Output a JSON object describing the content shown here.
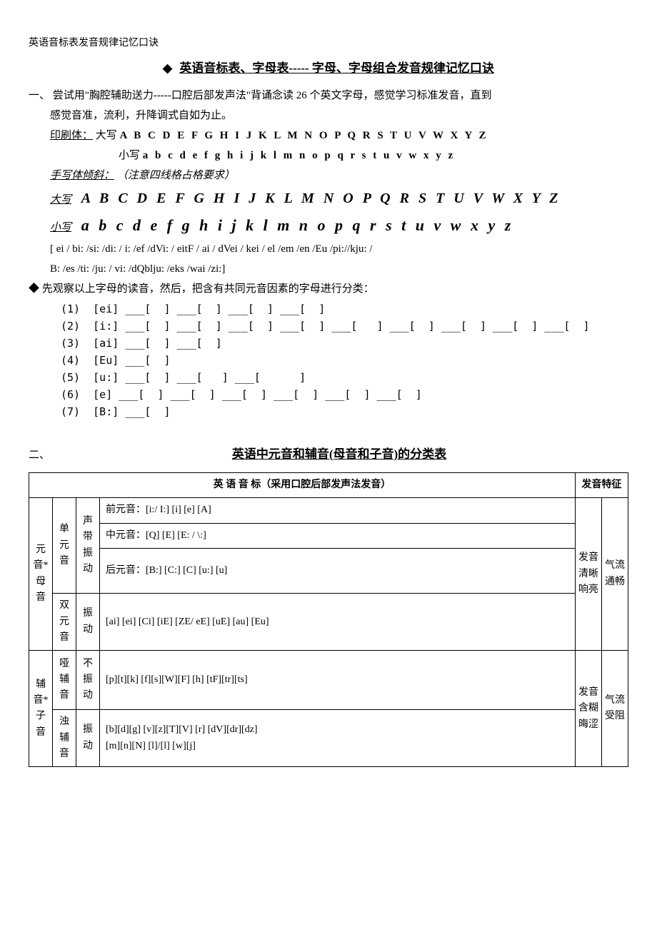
{
  "header_small": "英语音标表发音规律记忆口诀",
  "title_diamond": "◆",
  "title_text": "英语音标表、字母表----- 字母、字母组合发音规律记忆口诀",
  "sec1_num": "一、",
  "sec1_line1": "尝试用\"胸腔辅助送力-----口腔后部发声法\"背诵念读 26 个英文字母，感觉学习标准发音，直到",
  "sec1_line2": "感觉音准，流利，升降调式自如为止。",
  "print_label": "印刷体：",
  "print_upper_label": "大写   ",
  "print_upper": "A B C D E F G H I J K L M N O P Q R S T U V W X Y Z",
  "print_lower_label": "小写   ",
  "print_lower": "a b c d e f g h i j k l m n o p q r s t u v w x y z",
  "hand_label": "手写体倾斜：",
  "hand_note": "（注意四线格占格要求）",
  "hand_upper_label": "大写",
  "hand_upper": "A B C D E F G H I J K L M N O P Q R S T U V W X Y Z",
  "hand_lower_label": "小写",
  "hand_lower": "a b c d e f g h i j k l m n o p q r s t u v w x y z",
  "phon_line1": "[ ei / bi: /si: /di: /  i: /ef /dVi: / eitF / ai / dVei / kei / el /em /en /Eu /pi://kju: /",
  "phon_line2": "B: /es /ti: /ju: / vi: /dQblju: /eks /wai /zi:]",
  "diamond2": "◆",
  "observe_text": "先观察以上字母的读音，然后，把含有共同元音因素的字母进行分类：",
  "rows": [
    "(1)  [ei] ___[  ] ___[  ] ___[  ] ___[  ]",
    "(2)  [i:] ___[  ] ___[  ] ___[  ] ___[  ] ___[   ] ___[  ] ___[  ] ___[  ] ___[  ]",
    "(3)  [ai] ___[  ] ___[  ]",
    "(4)  [Eu] ___[  ]",
    "(5)  [u:] ___[  ] ___[   ] ___[      ]",
    "(6)  [e] ___[  ] ___[  ] ___[  ] ___[  ] ___[  ] ___[  ]",
    "(7)  [B:] ___[  ]"
  ],
  "sec2_num": "二、",
  "sec2_title": "英语中元音和辅音(母音和子音)的分类表",
  "table": {
    "header_main": "英   语   音   标（采用口腔后部发声法发音）",
    "header_right": "发音特征",
    "col1": [
      "元音*母音",
      "辅音*子音"
    ],
    "col2": [
      "单元音",
      "双元音",
      "哑辅音",
      "浊辅音"
    ],
    "col3": [
      "声带振动",
      "振动",
      "不振动",
      "振动"
    ],
    "vowel_rows": [
      "前元音：[i:/ I:] [i] [e] [A]",
      "中元音：[Q] [E] [E: / \\:]",
      "后元音：[B:] [C:] [C] [u:] [u]"
    ],
    "diph_row": "[ai] [ei] [Ci] [iE] [ZE/ eE] [uE] [au] [Eu]",
    "cons_row1": "[p][t][k]   [f][s][W][F]   [h]   [tF][tr][ts]",
    "cons_row2a": "[b][d][g]   [v][z][T][V]   [r]   [dV][dr][dz]",
    "cons_row2b": "[m][n][N]   [l]/[l]   [w][j]",
    "right_col1": [
      "发音清晰响亮",
      "发音含糊晦涩"
    ],
    "right_col2": [
      "气流通畅",
      "气流受阻"
    ]
  }
}
